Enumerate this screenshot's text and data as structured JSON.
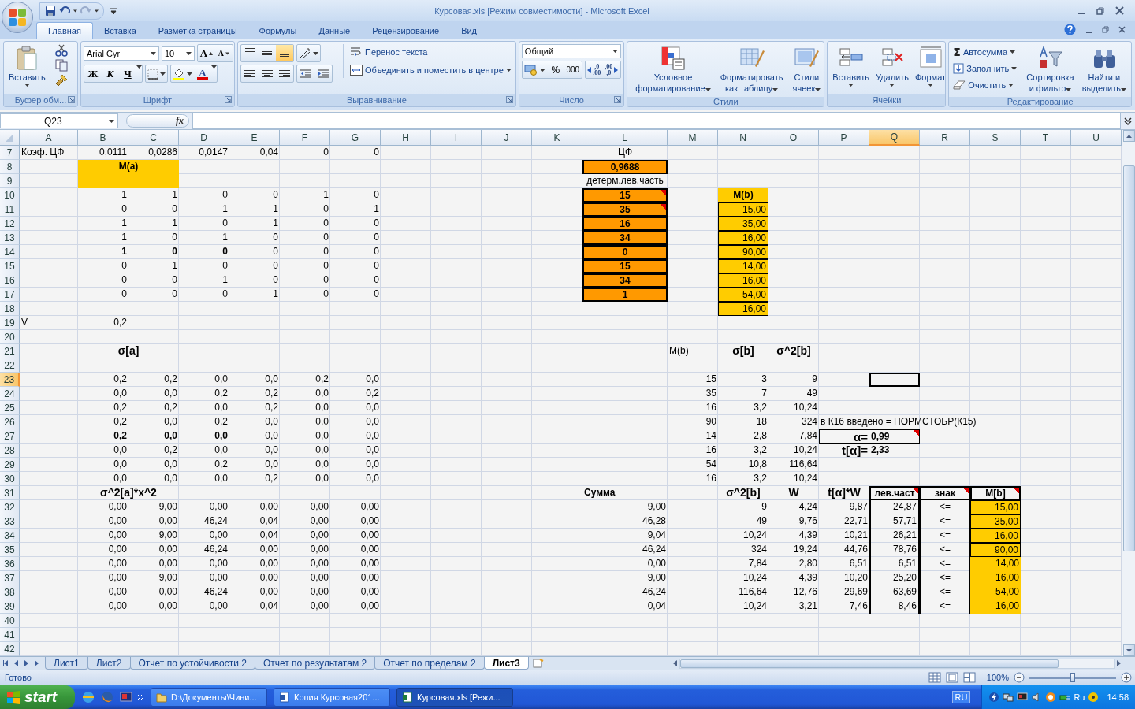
{
  "window": {
    "title": "Курсовая.xls  [Режим совместимости] - Microsoft Excel"
  },
  "ribbon_tabs": [
    {
      "label": "Главная",
      "selected": true
    },
    {
      "label": "Вставка",
      "selected": false
    },
    {
      "label": "Разметка страницы",
      "selected": false
    },
    {
      "label": "Формулы",
      "selected": false
    },
    {
      "label": "Данные",
      "selected": false
    },
    {
      "label": "Рецензирование",
      "selected": false
    },
    {
      "label": "Вид",
      "selected": false
    }
  ],
  "ribbon": {
    "groups": [
      {
        "kind": "clipboard",
        "label": "Буфер обм...",
        "paste": "Вставить"
      },
      {
        "kind": "font",
        "label": "Шрифт",
        "font": "Arial Cyr",
        "size": "10",
        "grow": "A",
        "shrink": "A",
        "styles": [
          {
            "text": "Ж",
            "kind": "bold"
          },
          {
            "text": "К",
            "kind": "italic"
          },
          {
            "text": "Ч",
            "kind": "underline"
          }
        ],
        "font_color": "A"
      },
      {
        "kind": "alignment",
        "label": "Выравнивание",
        "vertical": [
          {
            "selected": false
          },
          {
            "selected": false
          },
          {
            "selected": true
          }
        ],
        "horizontal": [
          {
            "selected": false
          },
          {
            "selected": false
          },
          {
            "selected": false
          }
        ],
        "wrap": "Перенос текста",
        "merge": "Объединить и поместить в центре"
      },
      {
        "kind": "number",
        "label": "Число",
        "format": "Общий",
        "percent": "%",
        "thousands": "000",
        "inc_decimal": [
          ",0",
          ",00"
        ],
        "dec_decimal": [
          ",00",
          ",0"
        ]
      },
      {
        "kind": "styles",
        "label": "Стили",
        "buttons": [
          {
            "lines": [
              "Условное",
              "форматирование"
            ]
          },
          {
            "lines": [
              "Форматировать",
              "как таблицу"
            ]
          },
          {
            "lines": [
              "Стили",
              "ячеек"
            ]
          }
        ]
      },
      {
        "kind": "cells",
        "label": "Ячейки",
        "buttons": [
          {
            "lines": [
              "Вставить"
            ]
          },
          {
            "lines": [
              "Удалить"
            ]
          },
          {
            "lines": [
              "Формат"
            ]
          }
        ]
      },
      {
        "kind": "editing",
        "label": "Редактирование",
        "sum_symbol": "Σ",
        "small": [
          "Автосумма",
          "Заполнить",
          "Очистить"
        ],
        "buttons": [
          {
            "lines": [
              "Сортировка",
              "и фильтр"
            ]
          },
          {
            "lines": [
              "Найти и",
              "выделить"
            ]
          }
        ]
      }
    ]
  },
  "formula_bar": {
    "name_box": "Q23",
    "function_label": "fx"
  },
  "sheet": {
    "columns": [
      {
        "label": "A",
        "selected": false
      },
      {
        "label": "B",
        "selected": false
      },
      {
        "label": "C",
        "selected": false
      },
      {
        "label": "D",
        "selected": false
      },
      {
        "label": "E",
        "selected": false
      },
      {
        "label": "F",
        "selected": false
      },
      {
        "label": "G",
        "selected": false
      },
      {
        "label": "H",
        "selected": false
      },
      {
        "label": "I",
        "selected": false
      },
      {
        "label": "J",
        "selected": false
      },
      {
        "label": "K",
        "selected": false
      },
      {
        "label": "L",
        "selected": false
      },
      {
        "label": "M",
        "selected": false
      },
      {
        "label": "N",
        "selected": false
      },
      {
        "label": "O",
        "selected": false
      },
      {
        "label": "P",
        "selected": false
      },
      {
        "label": "Q",
        "selected": true
      },
      {
        "label": "R",
        "selected": false
      },
      {
        "label": "S",
        "selected": false
      },
      {
        "label": "T",
        "selected": false
      },
      {
        "label": "U",
        "selected": false
      }
    ],
    "rows": [
      {
        "number": "7",
        "selected": false,
        "cells": {
          "A": {
            "text": "Коэф. ЦФ",
            "kind": "text"
          },
          "B": "0,0111",
          "C": "0,0286",
          "D": "0,0147",
          "E": "0,04",
          "F": "0",
          "G": "0",
          "L": {
            "text": "ЦФ",
            "kind": "center"
          }
        }
      },
      {
        "number": "8",
        "selected": false,
        "cells": {
          "B": {
            "text": "M(a)",
            "kind": "yellow-head",
            "merged": true
          },
          "L": {
            "text": "0,9688",
            "kind": "orange"
          }
        }
      },
      {
        "number": "9",
        "selected": false,
        "cells": {
          "B": {
            "kind": "yellow-fill",
            "merged": true
          },
          "L": {
            "text": "детерм.лев.часть",
            "kind": "center"
          }
        }
      },
      {
        "number": "10",
        "selected": false,
        "cells": {
          "B": "1",
          "C": "1",
          "D": "0",
          "E": "0",
          "F": "1",
          "G": "0",
          "L": {
            "text": "15",
            "kind": "orange",
            "comment": true
          },
          "N": {
            "text": "M(b)",
            "kind": "yellow-head"
          }
        }
      },
      {
        "number": "11",
        "selected": false,
        "cells": {
          "B": "0",
          "C": "0",
          "D": "1",
          "E": "1",
          "F": "0",
          "G": "1",
          "L": {
            "text": "35",
            "kind": "orange",
            "comment": true
          },
          "N": {
            "text": "15,00",
            "kind": "yellow"
          }
        }
      },
      {
        "number": "12",
        "selected": false,
        "cells": {
          "B": "1",
          "C": "1",
          "D": "0",
          "E": "1",
          "F": "0",
          "G": "0",
          "L": {
            "text": "16",
            "kind": "orange"
          },
          "N": {
            "text": "35,00",
            "kind": "yellow"
          }
        }
      },
      {
        "number": "13",
        "selected": false,
        "cells": {
          "B": "1",
          "C": "0",
          "D": "1",
          "E": "0",
          "F": "0",
          "G": "0",
          "L": {
            "text": "34",
            "kind": "orange"
          },
          "N": {
            "text": "16,00",
            "kind": "yellow"
          }
        }
      },
      {
        "number": "14",
        "selected": false,
        "cells": {
          "B": {
            "text": "1",
            "kind": "bold"
          },
          "C": {
            "text": "0",
            "kind": "bold"
          },
          "D": {
            "text": "0",
            "kind": "bold"
          },
          "E": "0",
          "F": "0",
          "G": "0",
          "L": {
            "text": "0",
            "kind": "orange"
          },
          "N": {
            "text": "90,00",
            "kind": "yellow"
          }
        }
      },
      {
        "number": "15",
        "selected": false,
        "cells": {
          "B": "0",
          "C": "1",
          "D": "0",
          "E": "0",
          "F": "0",
          "G": "0",
          "L": {
            "text": "15",
            "kind": "orange"
          },
          "N": {
            "text": "14,00",
            "kind": "yellow"
          }
        }
      },
      {
        "number": "16",
        "selected": false,
        "cells": {
          "B": "0",
          "C": "0",
          "D": "1",
          "E": "0",
          "F": "0",
          "G": "0",
          "L": {
            "text": "34",
            "kind": "orange"
          },
          "N": {
            "text": "16,00",
            "kind": "yellow"
          }
        }
      },
      {
        "number": "17",
        "selected": false,
        "cells": {
          "B": "0",
          "C": "0",
          "D": "0",
          "E": "1",
          "F": "0",
          "G": "0",
          "L": {
            "text": "1",
            "kind": "orange"
          },
          "N": {
            "text": "54,00",
            "kind": "yellow"
          }
        }
      },
      {
        "number": "18",
        "selected": false,
        "cells": {
          "N": {
            "text": "16,00",
            "kind": "yellow"
          }
        }
      },
      {
        "number": "19",
        "selected": false,
        "cells": {
          "A": {
            "text": "V",
            "kind": "text"
          },
          "B": "0,2"
        }
      },
      {
        "number": "20",
        "selected": false,
        "cells": {}
      },
      {
        "number": "21",
        "selected": false,
        "cells": {
          "B": {
            "text": "σ[a]",
            "kind": "title",
            "merged": true
          },
          "M": {
            "text": "M(b)",
            "kind": "text"
          },
          "N": {
            "text": "σ[b]",
            "kind": "title"
          },
          "O": {
            "text": "σ^2[b]",
            "kind": "title"
          }
        }
      },
      {
        "number": "22",
        "selected": false,
        "cells": {}
      },
      {
        "number": "23",
        "selected": true,
        "cells": {
          "B": "0,2",
          "C": "0,2",
          "D": "0,0",
          "E": "0,0",
          "F": "0,2",
          "G": "0,0",
          "M": "15",
          "N": "3",
          "O": "9",
          "Q": {
            "active": true
          }
        }
      },
      {
        "number": "24",
        "selected": false,
        "cells": {
          "B": "0,0",
          "C": "0,0",
          "D": "0,2",
          "E": "0,2",
          "F": "0,0",
          "G": "0,2",
          "M": "35",
          "N": "7",
          "O": "49"
        }
      },
      {
        "number": "25",
        "selected": false,
        "cells": {
          "B": "0,2",
          "C": "0,2",
          "D": "0,0",
          "E": "0,2",
          "F": "0,0",
          "G": "0,0",
          "M": "16",
          "N": "3,2",
          "O": "10,24"
        }
      },
      {
        "number": "26",
        "selected": false,
        "cells": {
          "B": "0,2",
          "C": "0,0",
          "D": "0,2",
          "E": "0,0",
          "F": "0,0",
          "G": "0,0",
          "M": "90",
          "N": "18",
          "O": "324",
          "P": {
            "text": "в К16 введено = НОРМСТОБР(К15)",
            "kind": "text"
          }
        }
      },
      {
        "number": "27",
        "selected": false,
        "cells": {
          "B": {
            "text": "0,2",
            "kind": "bold"
          },
          "C": {
            "text": "0,0",
            "kind": "bold"
          },
          "D": {
            "text": "0,0",
            "kind": "bold"
          },
          "E": "0,0",
          "F": "0,0",
          "G": "0,0",
          "M": "14",
          "N": "2,8",
          "O": "7,84",
          "P": {
            "text": "α=",
            "kind": "alpha-key"
          },
          "Q": {
            "text": "0,99",
            "kind": "alpha-val",
            "comment": true
          }
        }
      },
      {
        "number": "28",
        "selected": false,
        "cells": {
          "B": "0,0",
          "C": "0,2",
          "D": "0,0",
          "E": "0,0",
          "F": "0,0",
          "G": "0,0",
          "M": "16",
          "N": "3,2",
          "O": "10,24",
          "P": {
            "text": "t[α]=",
            "kind": "big-key"
          },
          "Q": {
            "text": "2,33",
            "kind": "big-val"
          }
        }
      },
      {
        "number": "29",
        "selected": false,
        "cells": {
          "B": "0,0",
          "C": "0,0",
          "D": "0,2",
          "E": "0,0",
          "F": "0,0",
          "G": "0,0",
          "M": "54",
          "N": "10,8",
          "O": "116,64"
        }
      },
      {
        "number": "30",
        "selected": false,
        "cells": {
          "B": "0,0",
          "C": "0,0",
          "D": "0,0",
          "E": "0,2",
          "F": "0,0",
          "G": "0,0",
          "M": "16",
          "N": "3,2",
          "O": "10,24"
        }
      },
      {
        "number": "31",
        "selected": false,
        "cells": {
          "B": {
            "text": "σ^2[a]*x^2",
            "kind": "title",
            "merged": true
          },
          "L": {
            "text": "Сумма",
            "kind": "bold-text"
          },
          "N": {
            "text": "σ^2[b]",
            "kind": "title"
          },
          "O": {
            "text": "W",
            "kind": "title"
          },
          "P": {
            "text": "t[α]*W",
            "kind": "title"
          },
          "Q": {
            "text": "лев.част",
            "kind": "head-box",
            "comment": true
          },
          "R": {
            "text": "знак",
            "kind": "head-box",
            "comment": true
          },
          "S": {
            "text": "M[b]",
            "kind": "head-box",
            "comment": true
          }
        }
      },
      {
        "number": "32",
        "selected": false,
        "cells": {
          "B": "0,00",
          "C": "9,00",
          "D": "0,00",
          "E": "0,00",
          "F": "0,00",
          "G": "0,00",
          "L": "9,00",
          "N": "9",
          "O": "4,24",
          "P": "9,87",
          "Q": {
            "text": "24,87",
            "kind": "box-col"
          },
          "R": {
            "text": "<=",
            "kind": "box-col-center"
          },
          "S": {
            "text": "15,00",
            "kind": "yellow"
          }
        }
      },
      {
        "number": "33",
        "selected": false,
        "cells": {
          "B": "0,00",
          "C": "0,00",
          "D": "46,24",
          "E": "0,04",
          "F": "0,00",
          "G": "0,00",
          "L": "46,28",
          "N": "49",
          "O": "9,76",
          "P": "22,71",
          "Q": {
            "text": "57,71",
            "kind": "box-col"
          },
          "R": {
            "text": "<=",
            "kind": "box-col-center"
          },
          "S": {
            "text": "35,00",
            "kind": "yellow"
          }
        }
      },
      {
        "number": "34",
        "selected": false,
        "cells": {
          "B": "0,00",
          "C": "9,00",
          "D": "0,00",
          "E": "0,04",
          "F": "0,00",
          "G": "0,00",
          "L": "9,04",
          "N": "10,24",
          "O": "4,39",
          "P": "10,21",
          "Q": {
            "text": "26,21",
            "kind": "box-col"
          },
          "R": {
            "text": "<=",
            "kind": "box-col-center"
          },
          "S": {
            "text": "16,00",
            "kind": "yellow"
          }
        }
      },
      {
        "number": "35",
        "selected": false,
        "cells": {
          "B": "0,00",
          "C": "0,00",
          "D": "46,24",
          "E": "0,00",
          "F": "0,00",
          "G": "0,00",
          "L": "46,24",
          "N": "324",
          "O": "19,24",
          "P": "44,76",
          "Q": {
            "text": "78,76",
            "kind": "box-col"
          },
          "R": {
            "text": "<=",
            "kind": "box-col-center"
          },
          "S": {
            "text": "90,00",
            "kind": "yellow"
          }
        }
      },
      {
        "number": "36",
        "selected": false,
        "cells": {
          "B": "0,00",
          "C": "0,00",
          "D": "0,00",
          "E": "0,00",
          "F": "0,00",
          "G": "0,00",
          "L": "0,00",
          "N": "7,84",
          "O": "2,80",
          "P": "6,51",
          "Q": {
            "text": "6,51",
            "kind": "box-col"
          },
          "R": {
            "text": "<=",
            "kind": "box-col-center"
          },
          "S": {
            "text": "14,00",
            "kind": "yellow-plain"
          }
        }
      },
      {
        "number": "37",
        "selected": false,
        "cells": {
          "B": "0,00",
          "C": "9,00",
          "D": "0,00",
          "E": "0,00",
          "F": "0,00",
          "G": "0,00",
          "L": "9,00",
          "N": "10,24",
          "O": "4,39",
          "P": "10,20",
          "Q": {
            "text": "25,20",
            "kind": "box-col"
          },
          "R": {
            "text": "<=",
            "kind": "box-col-center"
          },
          "S": {
            "text": "16,00",
            "kind": "yellow-plain"
          }
        }
      },
      {
        "number": "38",
        "selected": false,
        "cells": {
          "B": "0,00",
          "C": "0,00",
          "D": "46,24",
          "E": "0,00",
          "F": "0,00",
          "G": "0,00",
          "L": "46,24",
          "N": "116,64",
          "O": "12,76",
          "P": "29,69",
          "Q": {
            "text": "63,69",
            "kind": "box-col"
          },
          "R": {
            "text": "<=",
            "kind": "box-col-center"
          },
          "S": {
            "text": "54,00",
            "kind": "yellow-plain"
          }
        }
      },
      {
        "number": "39",
        "selected": false,
        "cells": {
          "B": "0,00",
          "C": "0,00",
          "D": "0,00",
          "E": "0,04",
          "F": "0,00",
          "G": "0,00",
          "L": "0,04",
          "N": "10,24",
          "O": "3,21",
          "P": "7,46",
          "Q": {
            "text": "8,46",
            "kind": "box-col"
          },
          "R": {
            "text": "<=",
            "kind": "box-col-center"
          },
          "S": {
            "text": "16,00",
            "kind": "yellow-plain"
          }
        }
      },
      {
        "number": "40",
        "selected": false,
        "cells": {}
      },
      {
        "number": "41",
        "selected": false,
        "cells": {}
      },
      {
        "number": "42",
        "selected": false,
        "cells": {}
      }
    ]
  },
  "sheet_tabs": [
    {
      "label": "Лист1",
      "selected": false
    },
    {
      "label": "Лист2",
      "selected": false
    },
    {
      "label": "Отчет по устойчивости 2",
      "selected": false
    },
    {
      "label": "Отчет по результатам 2",
      "selected": false
    },
    {
      "label": "Отчет по пределам 2",
      "selected": false
    },
    {
      "label": "Лист3",
      "selected": true
    }
  ],
  "status_bar": {
    "status": "Готово",
    "zoom": "100%",
    "zoom_slider": {
      "level": 0.5
    }
  },
  "taskbar": {
    "start": "start",
    "tasks": [
      {
        "label": "D:\\Документы\\Чини...",
        "selected": false
      },
      {
        "label": "Копия Курсовая201...",
        "selected": false
      },
      {
        "label": "Курсовая.xls  [Режи...",
        "selected": true
      }
    ],
    "language": "RU",
    "tray_language": "Ru",
    "clock": "14:58"
  }
}
